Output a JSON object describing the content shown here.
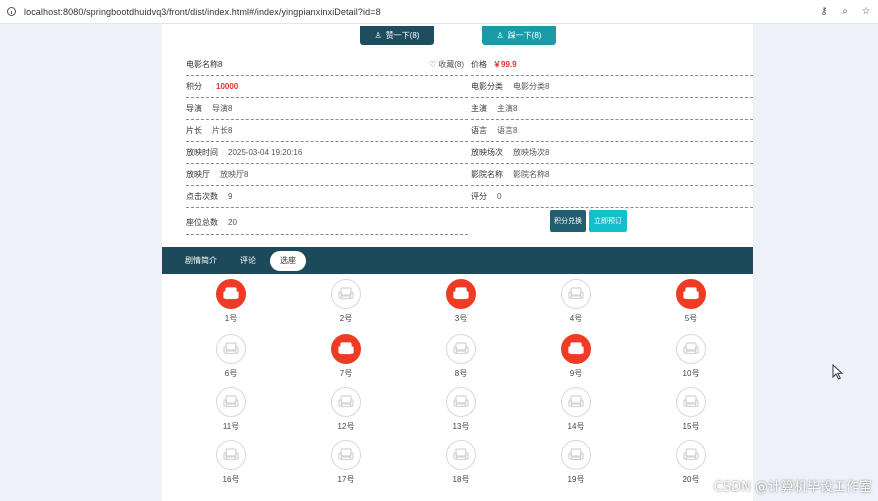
{
  "browser": {
    "url": "localhost:8080/springbootdhuidvq3/front/dist/index.html#/index/yingpianxinxiDetail?id=8"
  },
  "top_buttons": {
    "zan": "赞一下(8)",
    "cai": "踩一下(8)"
  },
  "info_left": [
    {
      "label": "电影名称8",
      "value": ""
    },
    {
      "label": "积分",
      "value": "10000"
    },
    {
      "label": "导演",
      "value": "导演8"
    },
    {
      "label": "片长",
      "value": "片长8"
    },
    {
      "label": "放映时间",
      "value": "2025-03-04 19:20:16"
    },
    {
      "label": "放映厅",
      "value": "放映厅8"
    },
    {
      "label": "点击次数",
      "value": "9"
    },
    {
      "label": "座位总数",
      "value": "20"
    }
  ],
  "favorite": "收藏(8)",
  "info_right": [
    {
      "label": "价格",
      "value": "￥99.9"
    },
    {
      "label": "电影分类",
      "value": "电影分类8"
    },
    {
      "label": "主演",
      "value": "主演8"
    },
    {
      "label": "语言",
      "value": "语言8"
    },
    {
      "label": "放映场次",
      "value": "放映场次8"
    },
    {
      "label": "影院名称",
      "value": "影院名称8"
    },
    {
      "label": "评分",
      "value": "0"
    }
  ],
  "actions": {
    "exchange": "积分兑换",
    "book": "立即预订"
  },
  "tabs": [
    "剧情简介",
    "评论",
    "选座"
  ],
  "active_tab": "选座",
  "seats": [
    {
      "label": "1号",
      "taken": true
    },
    {
      "label": "2号",
      "taken": false
    },
    {
      "label": "3号",
      "taken": true
    },
    {
      "label": "4号",
      "taken": false
    },
    {
      "label": "5号",
      "taken": true
    },
    {
      "label": "6号",
      "taken": false
    },
    {
      "label": "7号",
      "taken": true
    },
    {
      "label": "8号",
      "taken": false
    },
    {
      "label": "9号",
      "taken": true
    },
    {
      "label": "10号",
      "taken": false
    },
    {
      "label": "11号",
      "taken": false
    },
    {
      "label": "12号",
      "taken": false
    },
    {
      "label": "13号",
      "taken": false
    },
    {
      "label": "14号",
      "taken": false
    },
    {
      "label": "15号",
      "taken": false
    },
    {
      "label": "16号",
      "taken": false
    },
    {
      "label": "17号",
      "taken": false
    },
    {
      "label": "18号",
      "taken": false
    },
    {
      "label": "19号",
      "taken": false
    },
    {
      "label": "20号",
      "taken": false
    }
  ],
  "watermark": "CSDN @计算机毕设工作室",
  "colors": {
    "taken_seat": "#ef3b24",
    "tabbar": "#1d4a5a",
    "accent_red": "#e5322d"
  }
}
